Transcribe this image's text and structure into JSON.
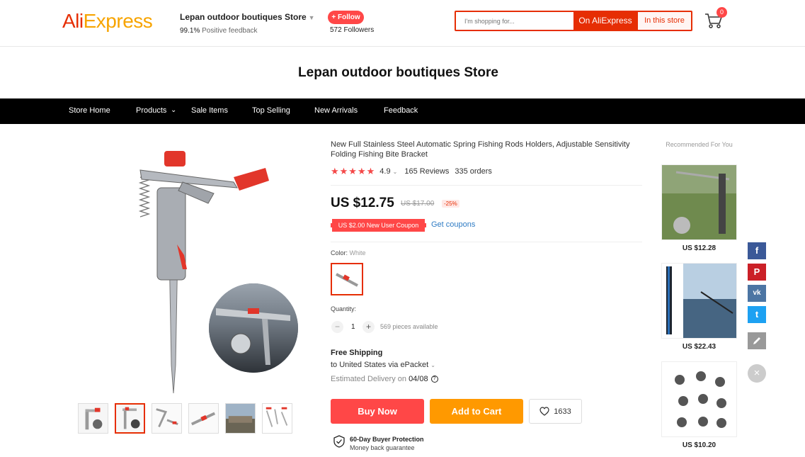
{
  "header": {
    "logo_part1": "Ali",
    "logo_part2": "Express",
    "store_name": "Lepan outdoor boutiques Store",
    "feedback_pct": "99.1%",
    "feedback_label": "Positive feedback",
    "follow_label": "+ Follow",
    "followers": "572 Followers",
    "search_placeholder": "I'm shopping for...",
    "search_on_ae": "On AliExpress",
    "search_in_store": "In this store",
    "cart_count": "0"
  },
  "banner": {
    "title": "Lepan outdoor boutiques Store"
  },
  "nav": {
    "items": [
      "Store Home",
      "Products",
      "Sale Items",
      "Top Selling",
      "New Arrivals",
      "Feedback"
    ]
  },
  "product": {
    "title": "New Full Stainless Steel Automatic Spring Fishing Rods Holders, Adjustable Sensitivity Folding Fishing Bite Bracket",
    "stars": "★★★★★",
    "rating": "4.9",
    "reviews": "165 Reviews",
    "orders": "335 orders",
    "price": "US $12.75",
    "old_price": "US $17.00",
    "discount": "-25%",
    "coupon": "US $2.00 New User Coupon",
    "get_coupons": "Get coupons",
    "color_label": "Color:",
    "color_value": "White",
    "quantity_label": "Quantity:",
    "quantity_minus": "−",
    "quantity_plus": "+",
    "quantity": "1",
    "available": "569 pieces available",
    "shipping_title": "Free Shipping",
    "shipping_to": "to United States via ePacket",
    "delivery_label": "Estimated Delivery on",
    "delivery_date": "04/08",
    "buy_now": "Buy Now",
    "add_to_cart": "Add to Cart",
    "wishlist_count": "1633",
    "protection_title": "60-Day Buyer Protection",
    "protection_sub": "Money back guarantee"
  },
  "recommended": {
    "title": "Recommended For You",
    "items": [
      {
        "price": "US $12.28"
      },
      {
        "price": "US $22.43"
      },
      {
        "price": "US $10.20"
      }
    ]
  },
  "share": {
    "facebook": "f",
    "pinterest": "P",
    "vk": "vk",
    "twitter": "t",
    "close": "×"
  },
  "colors": {
    "accent": "#e62e04",
    "buy": "#ff4747",
    "cart": "#ff9900",
    "facebook": "#3b5998",
    "pinterest": "#cb2027",
    "vk": "#4c75a3",
    "twitter": "#1da1f2",
    "edit": "#999999"
  }
}
